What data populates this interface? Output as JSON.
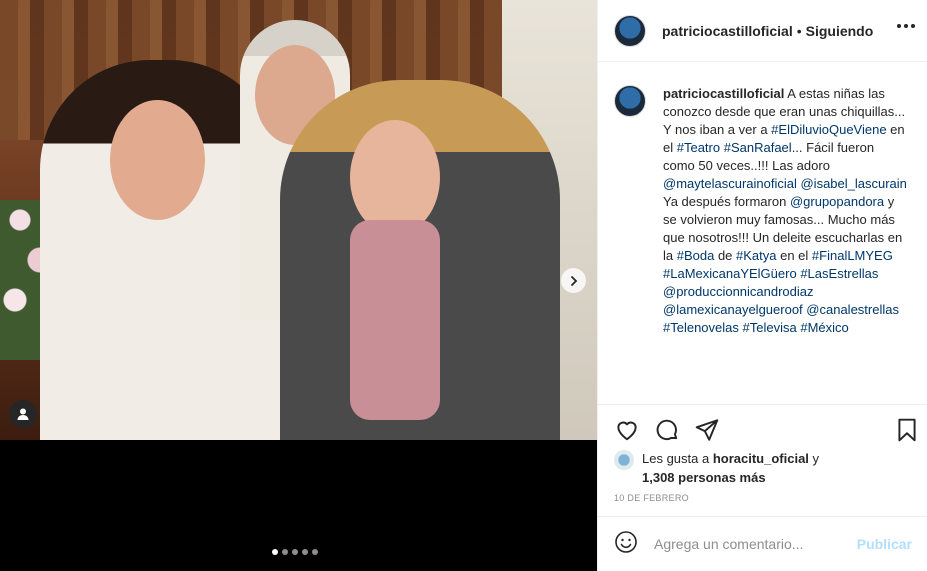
{
  "post": {
    "username": "patriciocastilloficial",
    "separator": "•",
    "following_label": "Siguiendo",
    "caption_parts": [
      {
        "t": "A estas niñas las conozco desde que eran unas chiquillas... Y nos iban a ver a ",
        "link": false
      },
      {
        "t": "#ElDiluvioQueViene",
        "link": true
      },
      {
        "t": " en el ",
        "link": false
      },
      {
        "t": "#Teatro",
        "link": true
      },
      {
        "t": " ",
        "link": false
      },
      {
        "t": "#SanRafael",
        "link": true
      },
      {
        "t": "... Fácil fueron como 50 veces..!!! Las adoro ",
        "link": false
      },
      {
        "t": "@maytelascurainoficial",
        "link": true
      },
      {
        "t": " ",
        "link": false
      },
      {
        "t": "@isabel_lascurain",
        "link": true
      },
      {
        "t": " Ya después formaron ",
        "link": false
      },
      {
        "t": "@grupopandora",
        "link": true
      },
      {
        "t": " y se volvieron muy famosas... Mucho más que nosotros!!! Un deleite escucharlas en la ",
        "link": false
      },
      {
        "t": "#Boda",
        "link": true
      },
      {
        "t": " de ",
        "link": false
      },
      {
        "t": "#Katya",
        "link": true
      },
      {
        "t": " en el ",
        "link": false
      },
      {
        "t": "#FinalLMYEG",
        "link": true
      },
      {
        "t": " ",
        "link": false
      },
      {
        "t": "#LaMexicanaYElGüero",
        "link": true
      },
      {
        "t": " ",
        "link": false
      },
      {
        "t": "#LasEstrellas",
        "link": true
      },
      {
        "t": " ",
        "link": false
      },
      {
        "t": "@produccionnicandrodiaz",
        "link": true
      },
      {
        "t": " ",
        "link": false
      },
      {
        "t": "@lamexicanayelgueroof",
        "link": true
      },
      {
        "t": " ",
        "link": false
      },
      {
        "t": "@canalestrellas",
        "link": true
      },
      {
        "t": " ",
        "link": false
      },
      {
        "t": "#Telenovelas",
        "link": true
      },
      {
        "t": " ",
        "link": false
      },
      {
        "t": "#Televisa",
        "link": true
      },
      {
        "t": " ",
        "link": false
      },
      {
        "t": "#México",
        "link": true
      }
    ],
    "likes_prefix": "Les gusta a",
    "likes_user": "horacitu_oficial",
    "likes_and": "y",
    "likes_count": "1,308 personas más",
    "date": "10 DE FEBRERO",
    "comment_placeholder": "Agrega un comentario...",
    "post_button": "Publicar",
    "carousel": {
      "total": 5,
      "active": 1
    }
  },
  "icons": {
    "more": "more-options-icon",
    "like": "heart-icon",
    "comment": "comment-icon",
    "share": "share-icon",
    "save": "bookmark-icon",
    "emoji": "emoji-icon",
    "next": "chevron-right-icon",
    "tag": "user-tag-icon"
  },
  "colors": {
    "link": "#00376b",
    "muted": "#8e8e8e",
    "post_disabled": "#b2dffc"
  }
}
